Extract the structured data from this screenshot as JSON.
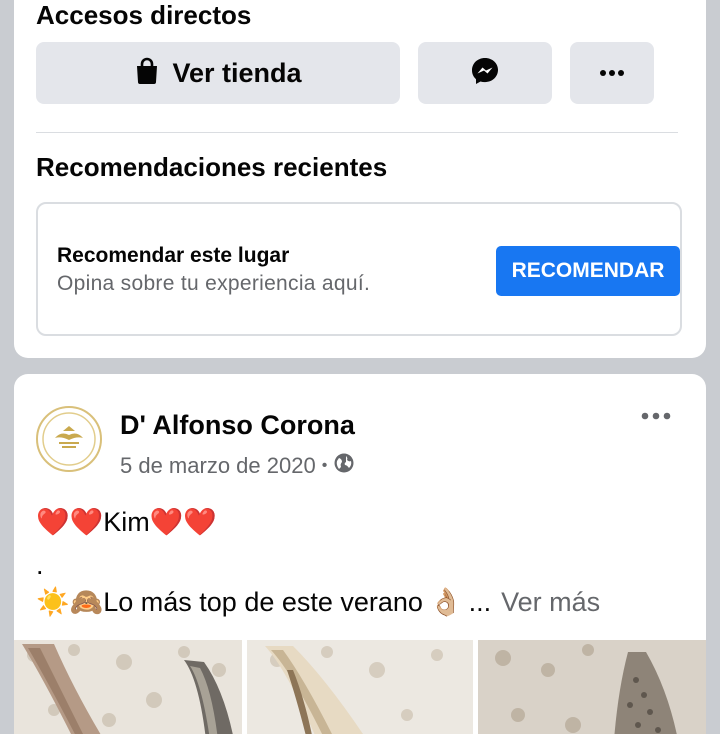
{
  "shortcuts": {
    "title": "Accesos directos",
    "shop_button_label": "Ver tienda"
  },
  "recommendations": {
    "title": "Recomendaciones recientes",
    "prompt_title": "Recomendar este lugar",
    "prompt_subtitle": "Opina sobre tu experiencia aquí.",
    "button_label": "RECOMENDAR"
  },
  "post": {
    "author": "D' Alfonso Corona",
    "date": "5 de marzo de 2020",
    "separator": "•",
    "line1_text": "Kim",
    "line2_text": ".",
    "line3_text": "Lo más top de este verano",
    "ellipsis": "...",
    "see_more": "Ver más",
    "emoji_hearts": "❤️",
    "emoji_sun": "☀️",
    "emoji_monkey": "🙈",
    "emoji_ok": "👌🏼"
  },
  "colors": {
    "accent": "#1877f2",
    "button_bg": "#e4e6eb",
    "secondary_text": "#65676b",
    "feed_bg": "#c9ccd1"
  },
  "icons": [
    "shopping-bag-icon",
    "messenger-icon",
    "more-dots-icon",
    "globe-icon"
  ]
}
